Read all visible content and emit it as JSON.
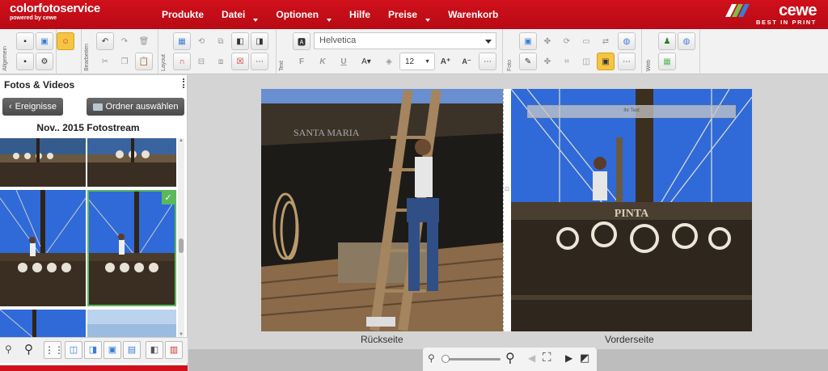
{
  "brand": {
    "name": "colorfotoservice",
    "powered": "powered by cewe"
  },
  "menu": [
    "Produkte",
    "Datei",
    "Optionen",
    "Hilfe",
    "Preise",
    "Warenkorb"
  ],
  "logo": {
    "word": "cewe",
    "tagline": "BEST IN PRINT"
  },
  "toolbar": {
    "groups": [
      "Allgemein",
      "Bearbeiten",
      "Layout",
      "Text",
      "Foto",
      "Web"
    ],
    "font": "Helvetica",
    "font_size": "12",
    "bold": "F",
    "italic": "K",
    "underline": "U"
  },
  "panel": {
    "title": "Fotos & Videos",
    "back_button": "Ereignisse",
    "folder_button": "Ordner auswählen",
    "stream_title": "Nov.. 2015 Fotostream"
  },
  "canvas": {
    "left_label": "Rückseite",
    "right_label": "Vorderseite",
    "ship_name": "PINTA",
    "back_ship_text": "SANTA MARIA",
    "title_box_text": "Ihr Text"
  },
  "colors": {
    "brand_red": "#d0101b",
    "accent_green": "#5cb85c"
  }
}
